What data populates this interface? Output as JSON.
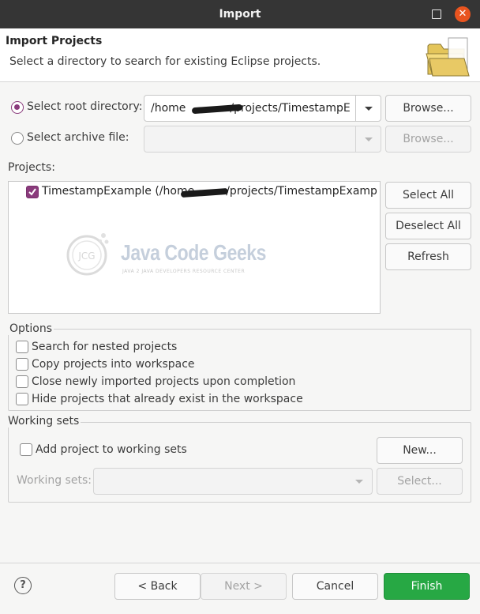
{
  "window": {
    "title": "Import"
  },
  "header": {
    "title": "Import Projects",
    "description": "Select a directory to search for existing Eclipse projects."
  },
  "source": {
    "root_label": "Select root directory:",
    "root_value_prefix": "/home",
    "root_value_suffix": "/projects/TimestampE",
    "archive_label": "Select archive file:",
    "archive_value": "",
    "browse_label": "Browse...",
    "browse_archive_label": "Browse..."
  },
  "projects": {
    "label": "Projects:",
    "items": [
      {
        "name_prefix": "TimestampExample (/home",
        "name_suffix": "/projects/TimestampExamp",
        "checked": true
      }
    ],
    "select_all": "Select All",
    "deselect_all": "Deselect All",
    "refresh": "Refresh",
    "watermark": {
      "brand": "Java Code Geeks",
      "tagline": "JAVA 2 JAVA DEVELOPERS RESOURCE CENTER"
    }
  },
  "options": {
    "title": "Options",
    "items": [
      "Search for nested projects",
      "Copy projects into workspace",
      "Close newly imported projects upon completion",
      "Hide projects that already exist in the workspace"
    ]
  },
  "working_sets": {
    "title": "Working sets",
    "add_label": "Add project to working sets",
    "new_label": "New...",
    "sets_label": "Working sets:",
    "sets_value": "",
    "select_label": "Select..."
  },
  "footer": {
    "help": "?",
    "back": "< Back",
    "next": "Next >",
    "cancel": "Cancel",
    "finish": "Finish"
  },
  "colors": {
    "accent": "#8a3b7c",
    "finish": "#27a844",
    "titlebar": "#353535",
    "close": "#e9541f"
  }
}
